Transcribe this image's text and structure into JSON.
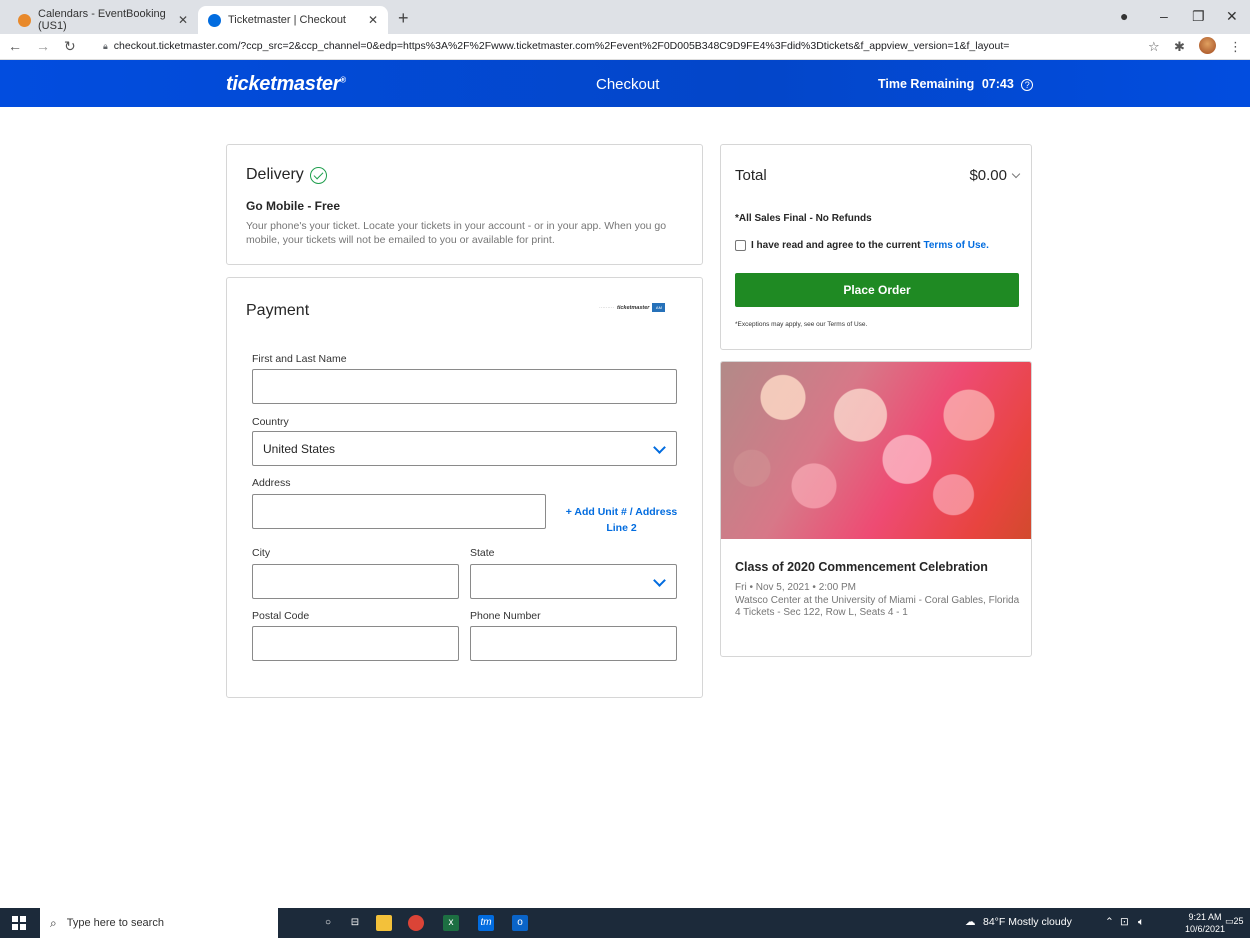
{
  "browser": {
    "tabs": [
      {
        "title": "Calendars - EventBooking (US1)",
        "active": false
      },
      {
        "title": "Ticketmaster | Checkout",
        "active": true
      }
    ],
    "url": "checkout.ticketmaster.com/?ccp_src=2&ccp_channel=0&edp=https%3A%2F%2Fwww.ticketmaster.com%2Fevent%2F0D005B348C9D9FE4%3Fdid%3Dtickets&f_appview_version=1&f_layout="
  },
  "header": {
    "logo": "ticketmaster",
    "title": "Checkout",
    "time_label": "Time Remaining",
    "time_value": "07:43"
  },
  "delivery": {
    "title": "Delivery",
    "method": "Go Mobile - Free",
    "description": "Your phone's your ticket. Locate your tickets in your account - or in your app. When you go mobile, your tickets will not be emailed to you or available for print."
  },
  "payment": {
    "title": "Payment",
    "name_label": "First and Last Name",
    "name_value": "",
    "country_label": "Country",
    "country_value": "United States",
    "address_label": "Address",
    "address_value": "",
    "add_unit": "+ Add Unit # / Address Line 2",
    "city_label": "City",
    "state_label": "State",
    "postal_label": "Postal Code",
    "phone_label": "Phone Number"
  },
  "total": {
    "label": "Total",
    "value": "$0.00",
    "final_notice": "*All Sales Final - No Refunds",
    "agree_text": "I have read and agree to the current",
    "terms_link": "Terms of Use.",
    "place_order": "Place Order",
    "exceptions": "*Exceptions may apply, see our Terms of Use."
  },
  "event": {
    "title": "Class of 2020 Commencement Celebration",
    "date": "Fri • Nov 5, 2021 • 2:00 PM",
    "venue": "Watsco Center at the University of Miami - Coral Gables, Florida",
    "tickets": "4 Tickets - Sec 122, Row L, Seats 4 - 1"
  },
  "taskbar": {
    "search_placeholder": "Type here to search",
    "weather": "84°F  Mostly cloudy",
    "time": "9:21 AM",
    "date": "10/6/2021",
    "notifications": "25"
  },
  "colors": {
    "brand_blue": "#024ddf",
    "link_blue": "#026cdf",
    "order_green": "#1f8a23"
  }
}
